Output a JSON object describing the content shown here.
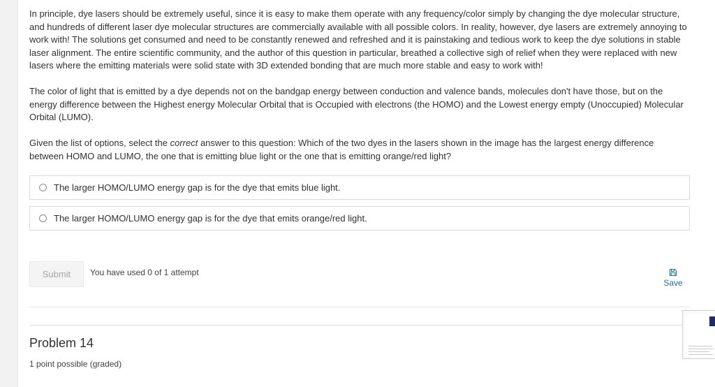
{
  "question": {
    "paragraph1": "In principle, dye lasers should be extremely useful, since it is easy to make them operate with any frequency/color simply by changing the dye molecular structure, and hundreds of different laser dye molecular structures are commercially available with all possible colors. In reality, however, dye lasers are extremely annoying to work with! The solutions get consumed and need to be constantly renewed and refreshed and it is painstaking and tedious work to keep the dye solutions in stable laser alignment. The entire scientific community, and the author of this question in particular, breathed a collective sigh of relief when they were replaced with new lasers where the emitting materials were solid state with 3D extended bonding that are much more stable and easy to work with!",
    "paragraph2": "The color of light that is emitted by a dye depends not on the bandgap energy between conduction and valence bands, molecules don't have those, but on the energy difference between the Highest energy Molecular Orbital that is Occupied with electrons (the HOMO) and the Lowest energy empty (Unoccupied) Molecular Orbital (LUMO).",
    "prompt_before": "Given the list of options, select the ",
    "prompt_emphasis": "correct",
    "prompt_after": " answer to this question: Which of the two dyes in the lasers shown in the image has the largest energy difference between HOMO and LUMO, the one that is emitting blue light or the one that is emitting orange/red light?"
  },
  "options": [
    {
      "label": "The larger HOMO/LUMO energy gap is for the dye that emits blue light."
    },
    {
      "label": "The larger HOMO/LUMO energy gap is for the dye that emits orange/red light."
    }
  ],
  "actions": {
    "submit_label": "Submit",
    "attempts_text": "You have used 0 of 1 attempt",
    "save_label": "Save",
    "save_icon": "floppy-disk-icon"
  },
  "next_problem": {
    "title": "Problem 14",
    "points": "1 point possible (graded)"
  },
  "colors": {
    "link": "#1b6ea8",
    "text": "#313131",
    "border": "#d9d9d9"
  }
}
